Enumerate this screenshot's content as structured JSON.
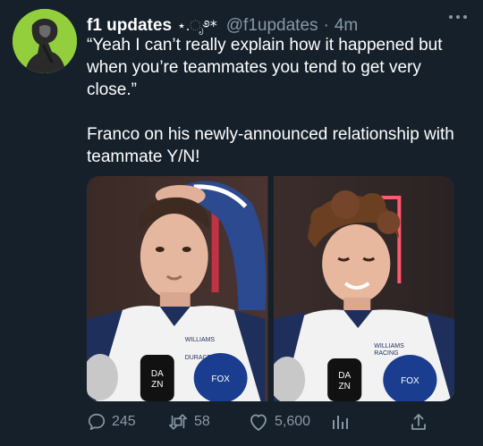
{
  "author": {
    "display_name": "f1 updates",
    "name_decoration": "⋆.ೃ࿔*",
    "handle": "@f1updates",
    "separator": "·",
    "time": "4m"
  },
  "tweet": {
    "paragraphs": [
      "“Yeah I can’t really explain how it happened but when you’re teammates you tend to get very close.”",
      "Franco on his newly-announced relationship with teammate Y/N!"
    ]
  },
  "media": {
    "photo_count": 2,
    "visible_logos": [
      "DAZN",
      "FOX SPORTS",
      "WILLIAMS RACING",
      "DURACELL"
    ]
  },
  "actions": {
    "replies": "245",
    "retweets": "58",
    "likes": "5,600"
  },
  "icons": {
    "reply": "reply-icon",
    "retweet": "retweet-icon",
    "like": "heart-icon",
    "stats": "analytics-icon",
    "share": "share-icon",
    "more": "more-icon"
  },
  "colors": {
    "background": "#15202b",
    "secondary_text": "#8899a6",
    "avatar_bg": "#93cf3c"
  }
}
